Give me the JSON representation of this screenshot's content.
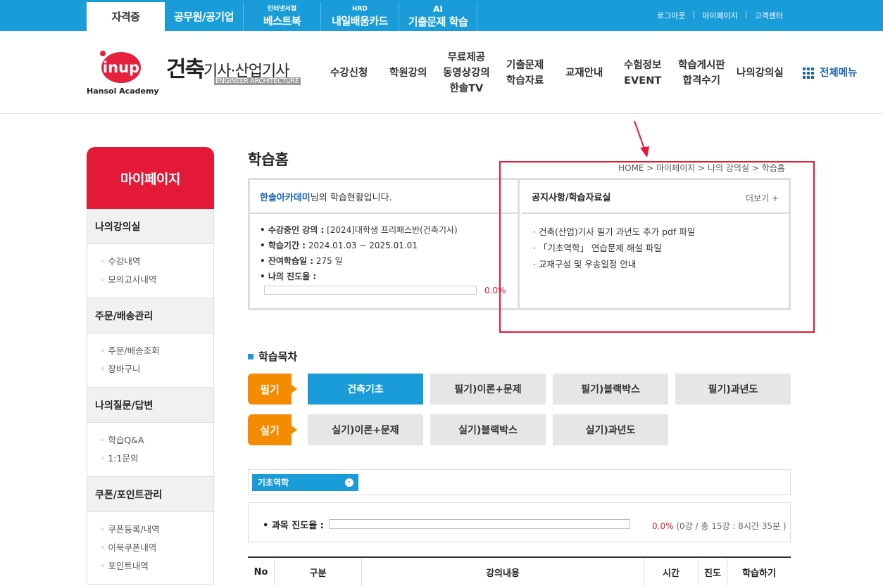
{
  "top_tabs": [
    {
      "small": "",
      "big": "자격증"
    },
    {
      "small": "",
      "big": "공무원/공기업"
    },
    {
      "small": "인터넷서점",
      "big": "베스트북"
    },
    {
      "small": "HRD",
      "big": "내일배움카드"
    },
    {
      "small": "AI",
      "big": "기출문제 학습"
    }
  ],
  "top_links": [
    "로그아웃",
    "마이페이지",
    "고객센터"
  ],
  "logo": {
    "text": "inup",
    "sub": "Hansol Academy"
  },
  "brand": {
    "main": "건축",
    "rest": "기사·산업기사",
    "eng": "ENGINEER ARCHITECTURE"
  },
  "gnb": {
    "items": [
      "수강신청",
      "학원강의",
      "무료제공",
      "동영상강의",
      "한솔TV",
      "기출문제",
      "학습자료",
      "교재안내",
      "수험정보",
      "EVENT",
      "학습게시판",
      "합격수기",
      "나의강의실"
    ],
    "all_menu": "전체메뉴"
  },
  "sidebar": {
    "title": "마이페이지",
    "sections": [
      {
        "title": "나의강의실",
        "items": [
          "수강내역",
          "모의고사내역"
        ]
      },
      {
        "title": "주문/배송관리",
        "items": [
          "주문/배송조회",
          "장바구니"
        ]
      },
      {
        "title": "나의질문/답변",
        "items": [
          "학습Q&A",
          "1:1문의"
        ]
      },
      {
        "title": "쿠폰/포인트관리",
        "items": [
          "쿠폰등록/내역",
          "이북쿠폰내역",
          "포인트내역"
        ]
      }
    ]
  },
  "page": {
    "title": "학습홈",
    "breadcrumb": "HOME > 마이페이지 > 나의 강의실 > 학습홈"
  },
  "status": {
    "user": "한솔아카데미",
    "user_suffix": "님의 학습현황입니다.",
    "course_label": "• 수강중인 강의 :",
    "course_value": "[2024]대학생 프리패스반(건축기사)",
    "period_label": "• 학습기간 :",
    "period_value": "2024.01.03 ~ 2025.01.01",
    "remain_label": "• 잔여학습일 :",
    "remain_value": "275 일",
    "progress_label": "• 나의 진도율 :",
    "progress_value": 0,
    "progress_text": "0.0%"
  },
  "notice": {
    "title": "공지사항/학습자료실",
    "more": "더보기 +",
    "items": [
      "· 건축(산업)기사 필기 과년도 추가 pdf 파일",
      "· 「기초역학」 연습문제 해설 파일",
      "· 교재구성 및 우송일정 안내"
    ]
  },
  "toc": {
    "title": "학습목차",
    "written_label": "필기",
    "written": [
      "건축기초",
      "필기)이론+문제",
      "필기)블랙박스",
      "필기)과년도"
    ],
    "practical_label": "실기",
    "practical": [
      "실기)이론+문제",
      "실기)블랙박스",
      "실기)과년도"
    ]
  },
  "subject": {
    "tab": "기초역학",
    "progress_label": "• 과목 진도율 :",
    "progress_value": 0,
    "progress_pct": "0.0%",
    "progress_detail": " (0강 / 총 15강 : 8시간 35분 )"
  },
  "table_headers": [
    "No",
    "구분",
    "강의내용",
    "시간",
    "진도",
    "학습하기"
  ],
  "colors": {
    "blue": "#1a9cd8",
    "red": "#e31937",
    "orange": "#f58b00"
  }
}
